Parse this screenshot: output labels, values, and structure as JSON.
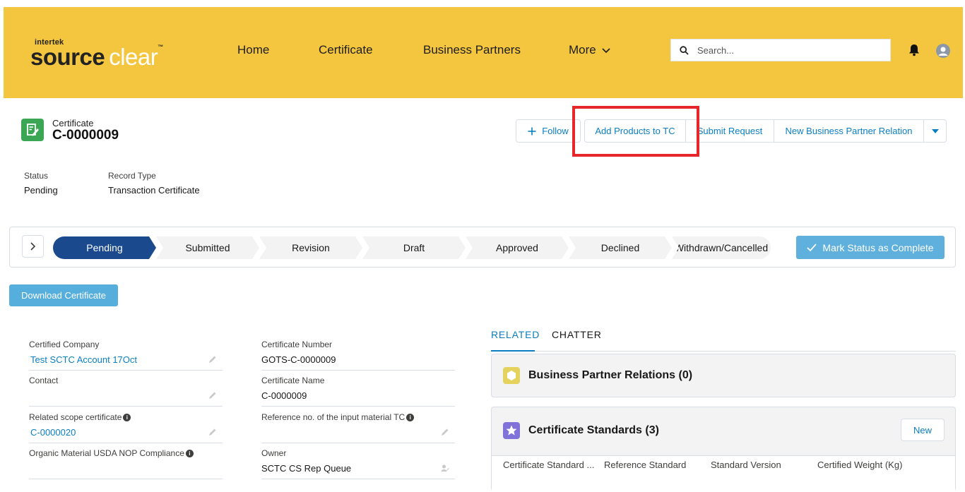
{
  "brand": {
    "sup": "intertek",
    "main": "source",
    "accent": "clear",
    "tm": "™"
  },
  "nav": {
    "home": "Home",
    "certificate": "Certificate",
    "business_partners": "Business Partners",
    "more": "More"
  },
  "search": {
    "placeholder": "Search..."
  },
  "record": {
    "object": "Certificate",
    "name": "C-0000009"
  },
  "actions": {
    "follow": "Follow",
    "add_products": "Add Products to TC",
    "submit_request": "Submit Request",
    "new_bp_relation": "New Business Partner Relation"
  },
  "highlights": {
    "status_label": "Status",
    "status_value": "Pending",
    "type_label": "Record Type",
    "type_value": "Transaction Certificate"
  },
  "path": {
    "stages": [
      "Pending",
      "Submitted",
      "Revision",
      "Draft",
      "Approved",
      "Declined",
      "Withdrawn/Cancelled"
    ],
    "active_index": 0,
    "mark_complete": "Mark Status as Complete"
  },
  "download": "Download Certificate",
  "fields": {
    "certified_company": {
      "label": "Certified Company",
      "value": "Test SCTC Account 17Oct"
    },
    "contact": {
      "label": "Contact",
      "value": ""
    },
    "related_scope": {
      "label": "Related scope certificate",
      "value": "C-0000020"
    },
    "organic_usda": {
      "label": "Organic Material USDA NOP Compliance",
      "value": ""
    },
    "certificate_number": {
      "label": "Certificate Number",
      "value": "GOTS-C-0000009"
    },
    "certificate_name": {
      "label": "Certificate Name",
      "value": "C-0000009"
    },
    "reference_no": {
      "label": "Reference no. of the input material TC",
      "value": ""
    },
    "owner": {
      "label": "Owner",
      "value": "SCTC CS Rep Queue"
    }
  },
  "tabs": {
    "related": "RELATED",
    "chatter": "CHATTER"
  },
  "related": {
    "bp_relations": "Business Partner Relations (0)",
    "cert_standards": "Certificate Standards (3)",
    "new": "New",
    "columns": [
      "Certificate Standard ...",
      "Reference Standard",
      "Standard Version",
      "Certified Weight (Kg)"
    ]
  },
  "colors": {
    "header": "#f4c63f",
    "link": "#0b7ec1",
    "path_active": "#1a4a8d",
    "highlight": "#e6262a"
  }
}
